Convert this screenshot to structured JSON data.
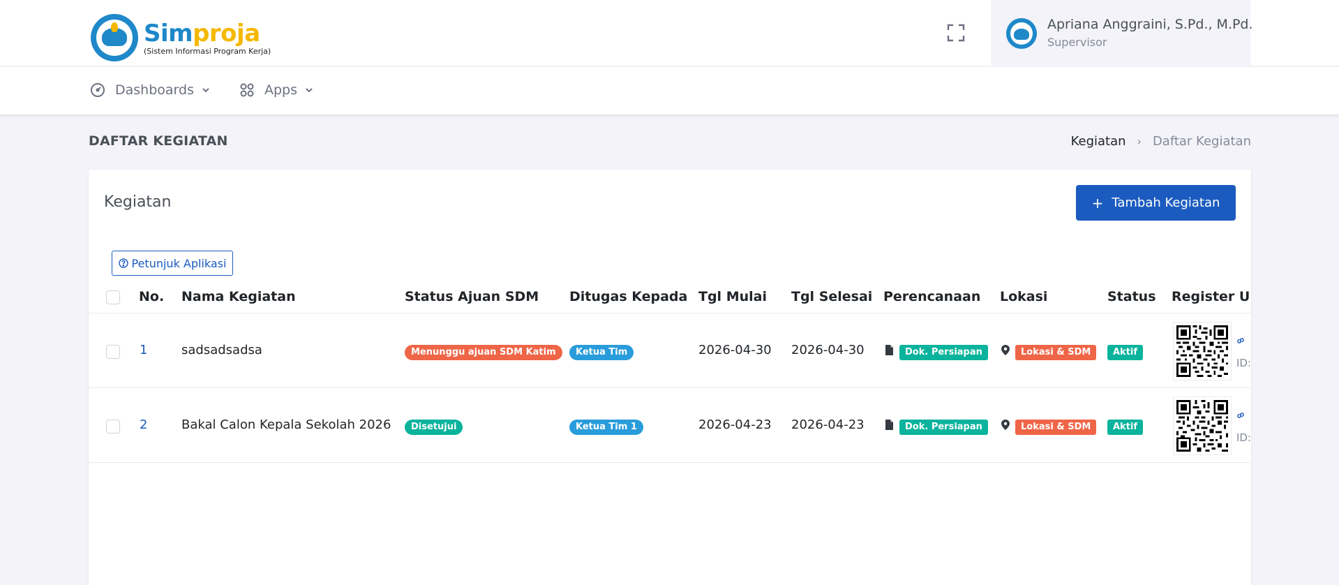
{
  "app": {
    "brand_part1": "Sim",
    "brand_part2": "proja",
    "brand_subtitle": "(Sistem Informasi Program Kerja)"
  },
  "user": {
    "name": "Apriana Anggraini, S.Pd., M.Pd.",
    "role": "Supervisor"
  },
  "nav": {
    "items": [
      {
        "label": "Dashboards",
        "icon": "speedometer-icon"
      },
      {
        "label": "Apps",
        "icon": "apps-grid-icon"
      }
    ]
  },
  "page": {
    "title": "DAFTAR KEGIATAN",
    "breadcrumb": [
      "Kegiatan",
      "Daftar Kegiatan"
    ]
  },
  "card": {
    "title": "Kegiatan",
    "add_button": "Tambah Kegiatan",
    "guide_button": "Petunjuk Aplikasi"
  },
  "table": {
    "headers": [
      "No.",
      "Nama Kegiatan",
      "Status Ajuan SDM",
      "Ditugas Kepada",
      "Tgl Mulai",
      "Tgl Selesai",
      "Perencanaan",
      "Lokasi",
      "Status",
      "Register URL"
    ],
    "rows": [
      {
        "no": "1",
        "nama": "sadsadsadsa",
        "status_ajuan": "Menunggu ajuan SDM Katim",
        "ditugas": "Ketua Tim",
        "tgl_mulai": "2026-04-30",
        "tgl_selesai": "2026-04-30",
        "perencanaan": "Dok. Persiapan",
        "lokasi": "Lokasi & SDM",
        "status": "Aktif",
        "id_label": "ID:"
      },
      {
        "no": "2",
        "nama": "Bakal Calon Kepala Sekolah 2026",
        "status_ajuan": "Disetujui",
        "ditugas": "Ketua Tim 1",
        "tgl_mulai": "2026-04-23",
        "tgl_selesai": "2026-04-23",
        "perencanaan": "Dok. Persiapan",
        "lokasi": "Lokasi & SDM",
        "status": "Aktif",
        "id_label": "ID:"
      }
    ]
  },
  "colors": {
    "primary": "#1b5bbf",
    "danger": "#ef6547",
    "success": "#0ab39c",
    "info": "#299cdb",
    "brand_blue": "#1e88c9",
    "brand_yellow": "#f5b800"
  }
}
